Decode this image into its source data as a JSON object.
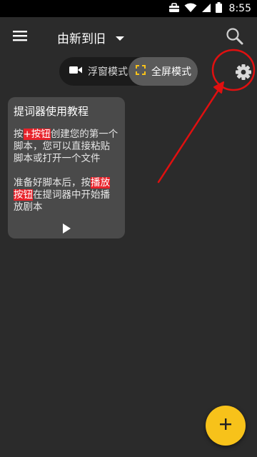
{
  "status_bar": {
    "time": "8:55",
    "icons": [
      "briefcase-icon",
      "wifi-icon",
      "signal-icon",
      "battery-icon"
    ]
  },
  "toolbar": {
    "sort_label": "由新到旧",
    "menu_icon": "menu-icon",
    "search_icon": "search-icon",
    "dropdown_icon": "caret-down-icon"
  },
  "mode_toggle": {
    "float_label": "浮窗模式",
    "full_label": "全屏模式",
    "selected": "full"
  },
  "settings": {
    "icon": "gear-icon"
  },
  "script_card": {
    "title": "提词器使用教程",
    "para1": {
      "pre": "按",
      "highlight": "+按钮",
      "post": "创建您的第一个脚本，您可以直接粘贴脚本或打开一个文件"
    },
    "para2": {
      "pre": "准备好脚本后，按",
      "highlight": "播放按钮",
      "post": "在提词器中开始播放剧本"
    }
  },
  "fab": {
    "label": "+"
  },
  "colors": {
    "background": "#2b2b2b",
    "card": "#4a4a4a",
    "highlight": "#e8232b",
    "fab": "#f7c21a",
    "annotation": "#e01010"
  }
}
